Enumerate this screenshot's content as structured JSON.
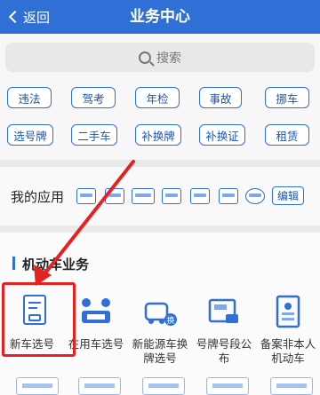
{
  "header": {
    "back_label": "返回",
    "title": "业务中心"
  },
  "search": {
    "placeholder": "搜索"
  },
  "tags": [
    "违法",
    "驾考",
    "年检",
    "事故",
    "挪车",
    "选号牌",
    "二手车",
    "补换牌",
    "补换证",
    "租赁"
  ],
  "my_apps": {
    "label": "我的应用",
    "edit_label": "编辑"
  },
  "section": {
    "title": "机动车业务"
  },
  "services": [
    {
      "label": "新车选号",
      "icon": "new-car-plate-icon"
    },
    {
      "label": "在用车选号",
      "icon": "used-car-plate-icon"
    },
    {
      "label": "新能源车换牌选号",
      "icon": "ev-plate-icon"
    },
    {
      "label": "号牌号段公布",
      "icon": "plate-range-icon"
    },
    {
      "label": "备案非本人机动车",
      "icon": "vehicle-record-icon"
    }
  ],
  "colors": {
    "header": "#2f6fd6",
    "highlight": "#e52222"
  }
}
